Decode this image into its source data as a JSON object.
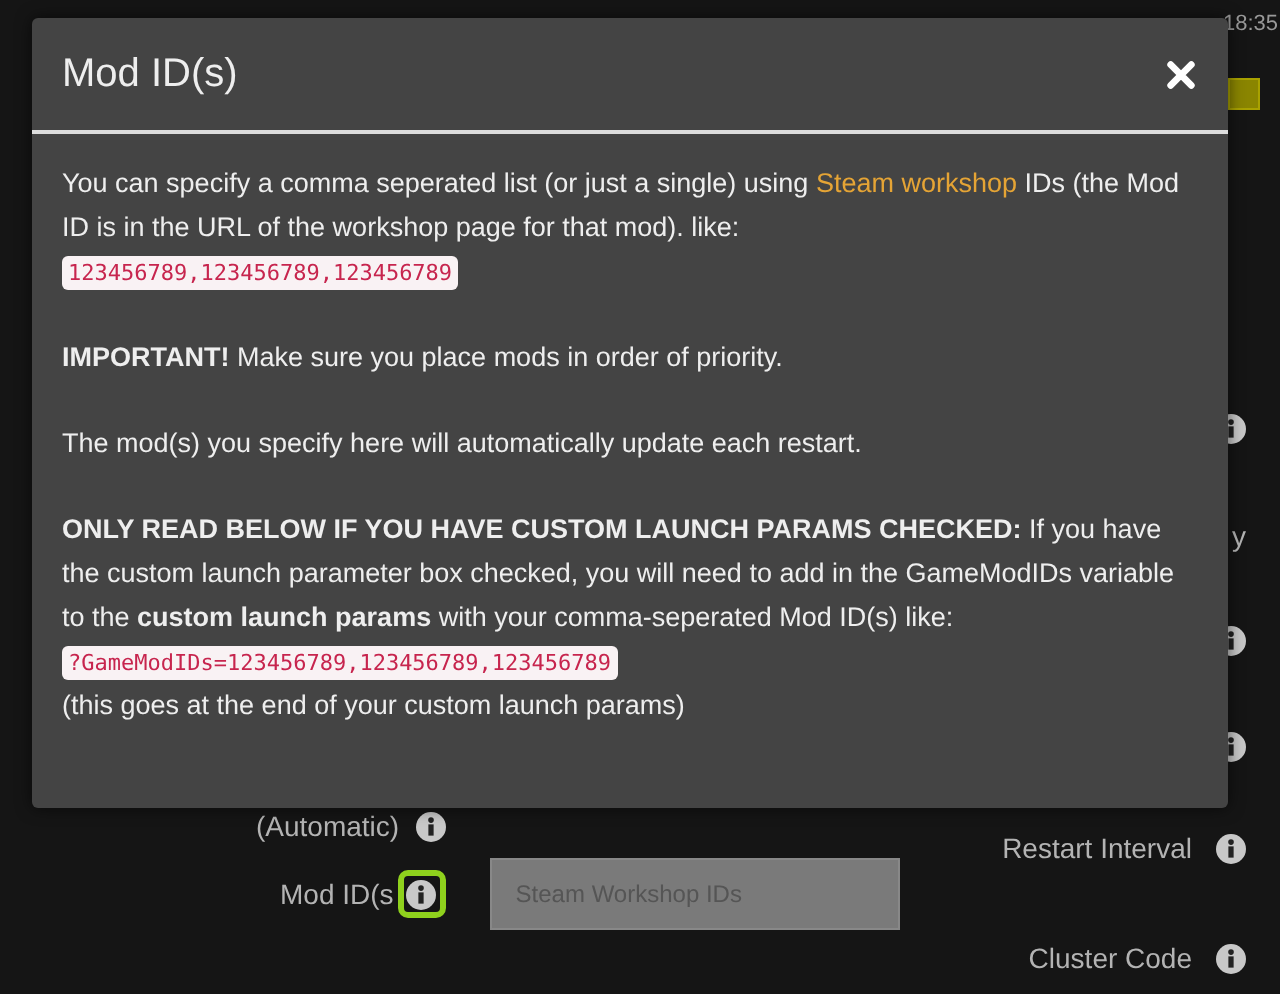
{
  "clock": "18:35",
  "checkbox": {
    "checked": true
  },
  "behind_labels": [
    {
      "text": "y"
    }
  ],
  "automatic_label": "(Automatic)",
  "restart_label": "Restart Interval",
  "mod_field": {
    "label": "Mod ID(s",
    "placeholder": "Steam Workshop IDs",
    "info_highlighted": true
  },
  "cluster_label": "Cluster Code",
  "modal": {
    "title": "Mod ID(s)",
    "paragraphs": [
      {
        "parts": [
          {
            "kind": "link_text",
            "before": "You can specify a comma seperated list (or just a single) using ",
            "link": "Steam workshop",
            "after": " IDs (the Mod ID is in the URL of the workshop page for that mod). like:"
          },
          {
            "kind": "code",
            "text": "123456789,123456789,123456789"
          }
        ]
      },
      {
        "parts": [
          {
            "kind": "text",
            "text": "**IMPORTANT!** Make sure you place mods in order of priority."
          }
        ]
      },
      {
        "parts": [
          {
            "kind": "text",
            "text": "The mod(s) you specify here will automatically update each restart."
          }
        ]
      },
      {
        "parts": [
          {
            "kind": "text",
            "text": "**ONLY READ BELOW IF YOU HAVE CUSTOM LAUNCH PARAMS CHECKED:** If you have the custom launch parameter box checked, you will need to add in the GameModIDs variable to the **custom launch params** with your comma-seperated Mod ID(s) like:"
          },
          {
            "kind": "code",
            "text": "?GameModIDs=123456789,123456789,123456789"
          },
          {
            "kind": "text",
            "text": "(this goes at the end of your custom launch params)"
          }
        ]
      }
    ]
  }
}
